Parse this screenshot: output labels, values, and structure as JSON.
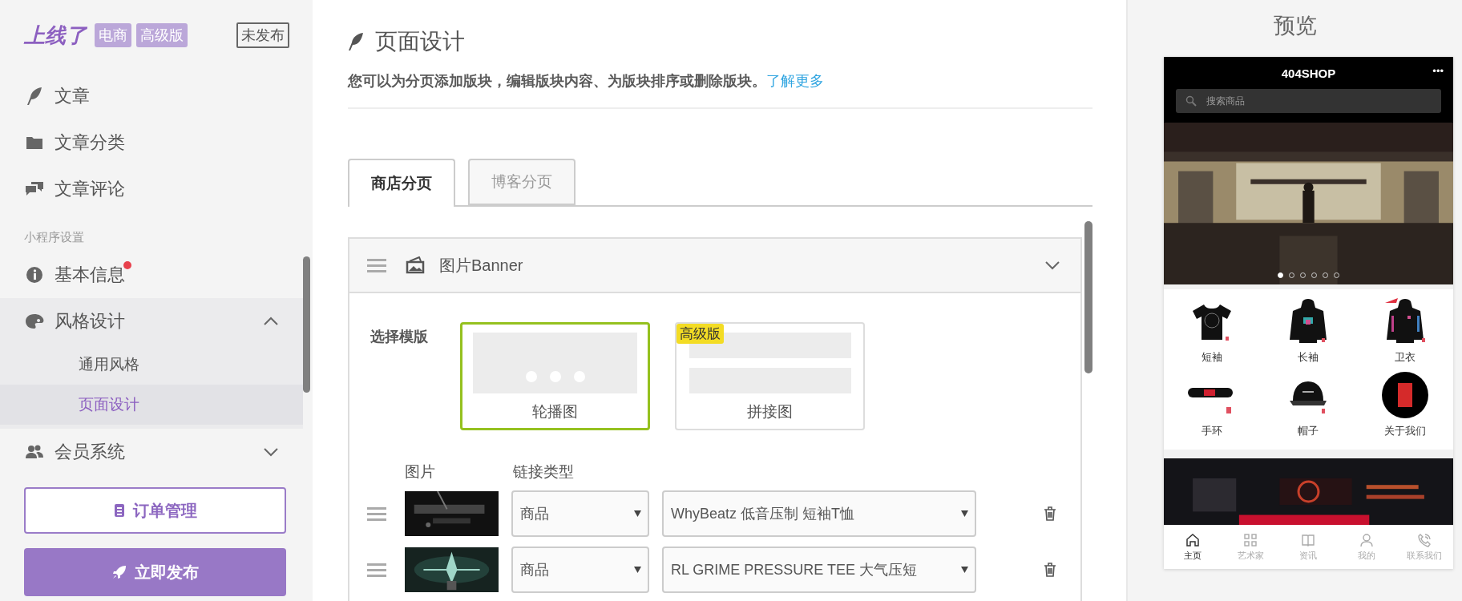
{
  "sidebar": {
    "logo": "上线了",
    "edition_badges": [
      "电商",
      "高级版"
    ],
    "publish_status": "未发布",
    "items": [
      {
        "kind": "item",
        "label": "文章",
        "notification": false
      },
      {
        "kind": "item",
        "label": "文章分类",
        "notification": false
      },
      {
        "kind": "item",
        "label": "文章评论",
        "notification": false
      },
      {
        "kind": "section",
        "label": "小程序设置"
      },
      {
        "kind": "item",
        "label": "基本信息",
        "notification": true
      },
      {
        "kind": "group",
        "label": "风格设计",
        "expanded": true,
        "children": [
          {
            "label": "通用风格",
            "selected": false
          },
          {
            "label": "页面设计",
            "selected": true
          }
        ]
      },
      {
        "kind": "group",
        "label": "会员系统",
        "expanded": false
      }
    ],
    "actions": [
      {
        "kind": "outline",
        "label": "订单管理"
      },
      {
        "kind": "primary",
        "label": "立即发布"
      }
    ]
  },
  "main": {
    "title": "页面设计",
    "description": "您可以为分页添加版块，编辑版块内容、为版块排序或删除版块。",
    "learn_more": "了解更多",
    "tabs": [
      {
        "label": "商店分页",
        "selected": true
      },
      {
        "label": "博客分页",
        "selected": false
      }
    ],
    "panel": {
      "title": "图片Banner",
      "expanded": true,
      "template_label": "选择模版",
      "templates": [
        {
          "kind": "carousel",
          "label": "轮播图",
          "selected": true
        },
        {
          "kind": "collage",
          "label": "拼接图",
          "selected": false,
          "badge": "高级版"
        }
      ],
      "columns": [
        "图片",
        "链接类型"
      ],
      "rows": [
        {
          "link_type": "商品",
          "target": "WhyBeatz 低音压制 短袖T恤"
        },
        {
          "link_type": "商品",
          "target": "RL GRIME PRESSURE TEE 大气压短"
        }
      ]
    }
  },
  "preview": {
    "title": "预览",
    "phone": {
      "title": "404SHOP",
      "menu": "•••",
      "search_placeholder": "搜索商品",
      "dots": [
        {
          "selected": true
        },
        {
          "selected": false
        },
        {
          "selected": false
        },
        {
          "selected": false
        },
        {
          "selected": false
        },
        {
          "selected": false
        }
      ],
      "categories": [
        {
          "label": "短袖"
        },
        {
          "label": "长袖"
        },
        {
          "label": "卫衣"
        },
        {
          "label": "手环"
        },
        {
          "label": "帽子"
        },
        {
          "label": "关于我们"
        }
      ],
      "nav": [
        {
          "label": "主页",
          "selected": true
        },
        {
          "label": "艺术家",
          "selected": false
        },
        {
          "label": "资讯",
          "selected": false
        },
        {
          "label": "我的",
          "selected": false
        },
        {
          "label": "联系我们",
          "selected": false
        }
      ]
    }
  }
}
